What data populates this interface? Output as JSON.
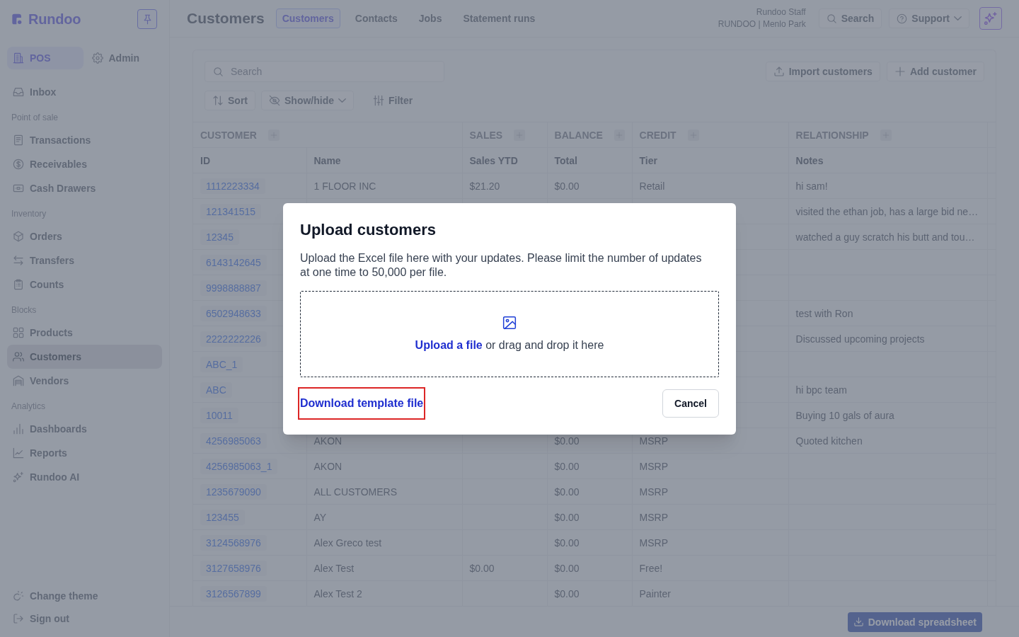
{
  "sidebar": {
    "logo": "Rundoo",
    "modes": [
      {
        "label": "POS",
        "selected": true
      },
      {
        "label": "Admin",
        "selected": false
      }
    ],
    "sections": [
      {
        "items": [
          {
            "label": "Inbox",
            "selected": false
          }
        ]
      },
      {
        "heading": "Point of sale",
        "items": [
          {
            "label": "Transactions",
            "selected": false
          },
          {
            "label": "Receivables",
            "selected": false
          },
          {
            "label": "Cash Drawers",
            "selected": false
          }
        ]
      },
      {
        "heading": "Inventory",
        "items": [
          {
            "label": "Orders",
            "selected": false
          },
          {
            "label": "Transfers",
            "selected": false
          },
          {
            "label": "Counts",
            "selected": false
          }
        ]
      },
      {
        "heading": "Blocks",
        "items": [
          {
            "label": "Products",
            "selected": false
          },
          {
            "label": "Customers",
            "selected": true
          },
          {
            "label": "Vendors",
            "selected": false
          }
        ]
      },
      {
        "heading": "Analytics",
        "items": [
          {
            "label": "Dashboards",
            "selected": false
          },
          {
            "label": "Reports",
            "selected": false
          },
          {
            "label": "Rundoo AI",
            "selected": false
          }
        ]
      }
    ],
    "footer_items": [
      "Change theme",
      "Sign out"
    ]
  },
  "header": {
    "title": "Customers",
    "tabs": [
      {
        "label": "Customers",
        "selected": true
      },
      {
        "label": "Contacts",
        "selected": false
      },
      {
        "label": "Jobs",
        "selected": false
      },
      {
        "label": "Statement runs",
        "selected": false
      }
    ],
    "user": {
      "name": "Rundoo Staff",
      "org": "RUNDOO | Menlo Park"
    },
    "search_button": "Search",
    "support_button": "Support"
  },
  "customers": {
    "search": {
      "placeholder": "Search"
    },
    "actions": [
      "Import customers",
      "Add customer"
    ],
    "view_controls": [
      {
        "label": "Sort",
        "kind": "button"
      },
      {
        "label": "Show/hide",
        "kind": "dropdown"
      },
      {
        "label": "Filter",
        "kind": "ghost"
      }
    ],
    "table": {
      "column_groups": [
        {
          "label": "CUSTOMER",
          "columns": [
            "ID",
            "Name"
          ]
        },
        {
          "label": "SALES",
          "columns": [
            "Sales YTD"
          ]
        },
        {
          "label": "BALANCE",
          "columns": [
            "Total"
          ]
        },
        {
          "label": "CREDIT",
          "columns": [
            "Tier"
          ]
        },
        {
          "label": "RELATIONSHIP",
          "columns": [
            "Notes"
          ]
        }
      ],
      "rows": [
        {
          "id": "1112223334",
          "name": "1 FLOOR INC",
          "sales_ytd": "$21.20",
          "total": "$0.00",
          "tier": "Retail",
          "notes": "hi sam!"
        },
        {
          "id": "121341515",
          "notes": "visited the ethan job, has a large bid ne…"
        },
        {
          "id": "12345",
          "notes": "watched a guy scratch his butt and tou…"
        },
        {
          "id": "6143142645"
        },
        {
          "id": "9998888887"
        },
        {
          "id": "6502948633",
          "notes": "test with Ron"
        },
        {
          "id": "2222222226",
          "notes": "Discussed upcoming projects"
        },
        {
          "id": "ABC_1"
        },
        {
          "id": "ABC",
          "notes": "hi bpc team"
        },
        {
          "id": "10011",
          "notes": "Buying 10 gals of aura"
        },
        {
          "id": "4256985063",
          "name": "AKON",
          "total": "$0.00",
          "tier": "MSRP",
          "notes": "Quoted kitchen"
        },
        {
          "id": "4256985063_1",
          "name": "AKON",
          "total": "$0.00",
          "tier": "MSRP"
        },
        {
          "id": "1235679090",
          "name": "ALL CUSTOMERS",
          "total": "$0.00",
          "tier": "MSRP"
        },
        {
          "id": "123455",
          "name": "AY",
          "total": "$0.00",
          "tier": "MSRP"
        },
        {
          "id": "3124568976",
          "name": "Alex Greco test",
          "total": "$0.00",
          "tier": "MSRP"
        },
        {
          "id": "3127658976",
          "name": "Alex Test",
          "sales_ytd": "$0.00",
          "total": "$0.00",
          "tier": "Free!"
        },
        {
          "id": "3126567899",
          "name": "Alex Test 2",
          "total": "$0.00",
          "tier": "Painter"
        }
      ]
    }
  },
  "bottom_bar": {
    "download_button": "Download spreadsheet"
  },
  "modal": {
    "title": "Upload customers",
    "description": "Upload the Excel file here with your updates. Please limit the number of updates at one time to 50,000 per file.",
    "dropzone": {
      "link": "Upload a file",
      "text": "or drag and drop it here"
    },
    "template_link": {
      "label": "Download template file",
      "highlighted": true
    },
    "cancel_button": "Cancel"
  }
}
